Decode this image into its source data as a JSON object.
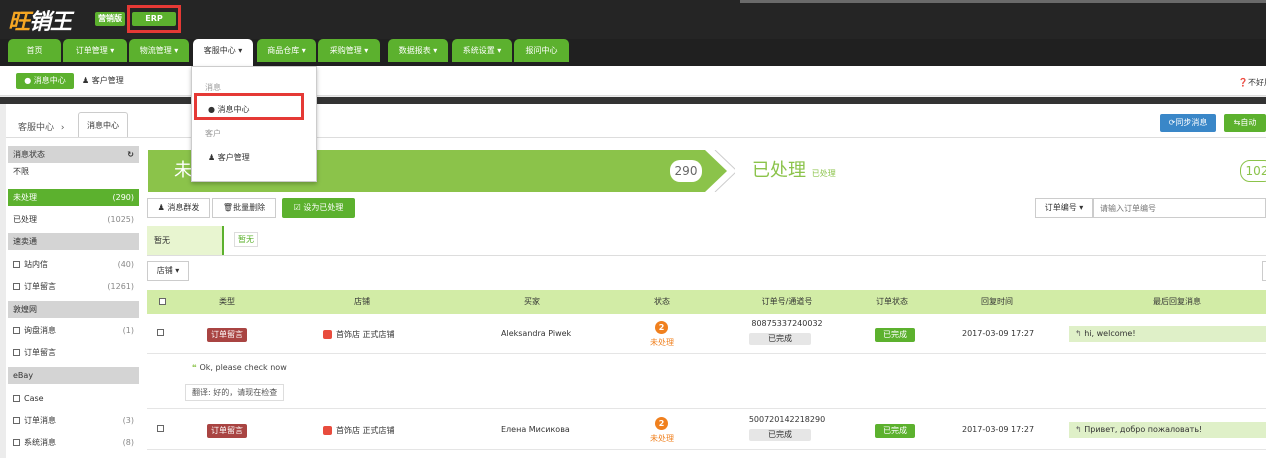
{
  "header": {
    "logo": "旺销王",
    "badge_marketing": "营销版",
    "badge_erp": "ERP"
  },
  "nav": {
    "tabs": [
      "首页",
      "订单管理 ▾",
      "物流管理 ▾",
      "客服中心 ▾",
      "商品仓库 ▾",
      "采购管理 ▾",
      "数据报表 ▾",
      "系统设置 ▾",
      "报问中心"
    ]
  },
  "subnav": {
    "message_center": "消息中心",
    "customer_manage": "客户管理",
    "right_notice": "不好用"
  },
  "dropdown": {
    "group1": "消息",
    "item1": "消息中心",
    "group2": "客户",
    "item2": "客户管理"
  },
  "breadcrumb": {
    "root": "客服中心",
    "sep": "›",
    "current": "消息中心"
  },
  "actions": {
    "sync": "同步消息",
    "auto": "自动"
  },
  "sidebar": {
    "rows": [
      {
        "label": "消息状态",
        "type": "head",
        "icon": "refresh-icon"
      },
      {
        "label": "不限",
        "type": "item"
      },
      {
        "label": "未处理",
        "count": "(290)",
        "type": "active"
      },
      {
        "label": "已处理",
        "count": "(1025)",
        "type": "item"
      },
      {
        "label": "速卖通",
        "type": "head"
      },
      {
        "label": "站内信",
        "count": "(40)",
        "type": "check"
      },
      {
        "label": "订单留言",
        "count": "(1261)",
        "type": "check"
      },
      {
        "label": "敦煌网",
        "type": "head"
      },
      {
        "label": "询盘消息",
        "count": "(1)",
        "type": "check"
      },
      {
        "label": "订单留言",
        "type": "check"
      },
      {
        "label": "eBay",
        "type": "head"
      },
      {
        "label": "Case",
        "type": "check"
      },
      {
        "label": "订单消息",
        "count": "(3)",
        "type": "check"
      },
      {
        "label": "系统消息",
        "count": "(8)",
        "type": "check"
      }
    ]
  },
  "status_tabs": {
    "unprocessed_partial": "未",
    "unprocessed_count": "290",
    "processed": "已处理",
    "processed_sub": "已处理",
    "processed_count": "102"
  },
  "toolbar": {
    "bulk_send": "消息群发",
    "bulk_delete": "批量删除",
    "mark_done": "设为已处理",
    "order_no_select": "订单编号 ▾",
    "search_placeholder": "请输入订单编号"
  },
  "filter": {
    "label": "暂无",
    "chip": "暂无",
    "store_select": "店铺 ▾"
  },
  "table": {
    "headers": [
      "类型",
      "店铺",
      "买家",
      "状态",
      "订单号/通道号",
      "订单状态",
      "回复时间",
      "最后回复消息"
    ],
    "rows": [
      {
        "type": "订单留言",
        "store": "首饰店 正式店铺",
        "buyer": "Aleksandra Piwek",
        "status_num": "2",
        "status": "未处理",
        "order_no": "80875337240032",
        "channel": "已完成",
        "order_status": "已完成",
        "time": "2017-03-09 17:27",
        "last_msg": "hi, welcome!",
        "quote": "Ok, please check now",
        "translation": "翻译: 好的，请现在检查"
      },
      {
        "type": "订单留言",
        "store": "首饰店 正式店铺",
        "buyer": "Елена Мисикова",
        "status_num": "2",
        "status": "未处理",
        "order_no": "500720142218290",
        "channel": "已完成",
        "order_status": "已完成",
        "time": "2017-03-09 17:27",
        "last_msg": "Привет, добро пожаловать!"
      }
    ]
  },
  "colors": {
    "accent_green": "#5cb12e",
    "header_green": "#d2eca6",
    "highlight_red": "#e53935",
    "topbar": "#252525"
  }
}
